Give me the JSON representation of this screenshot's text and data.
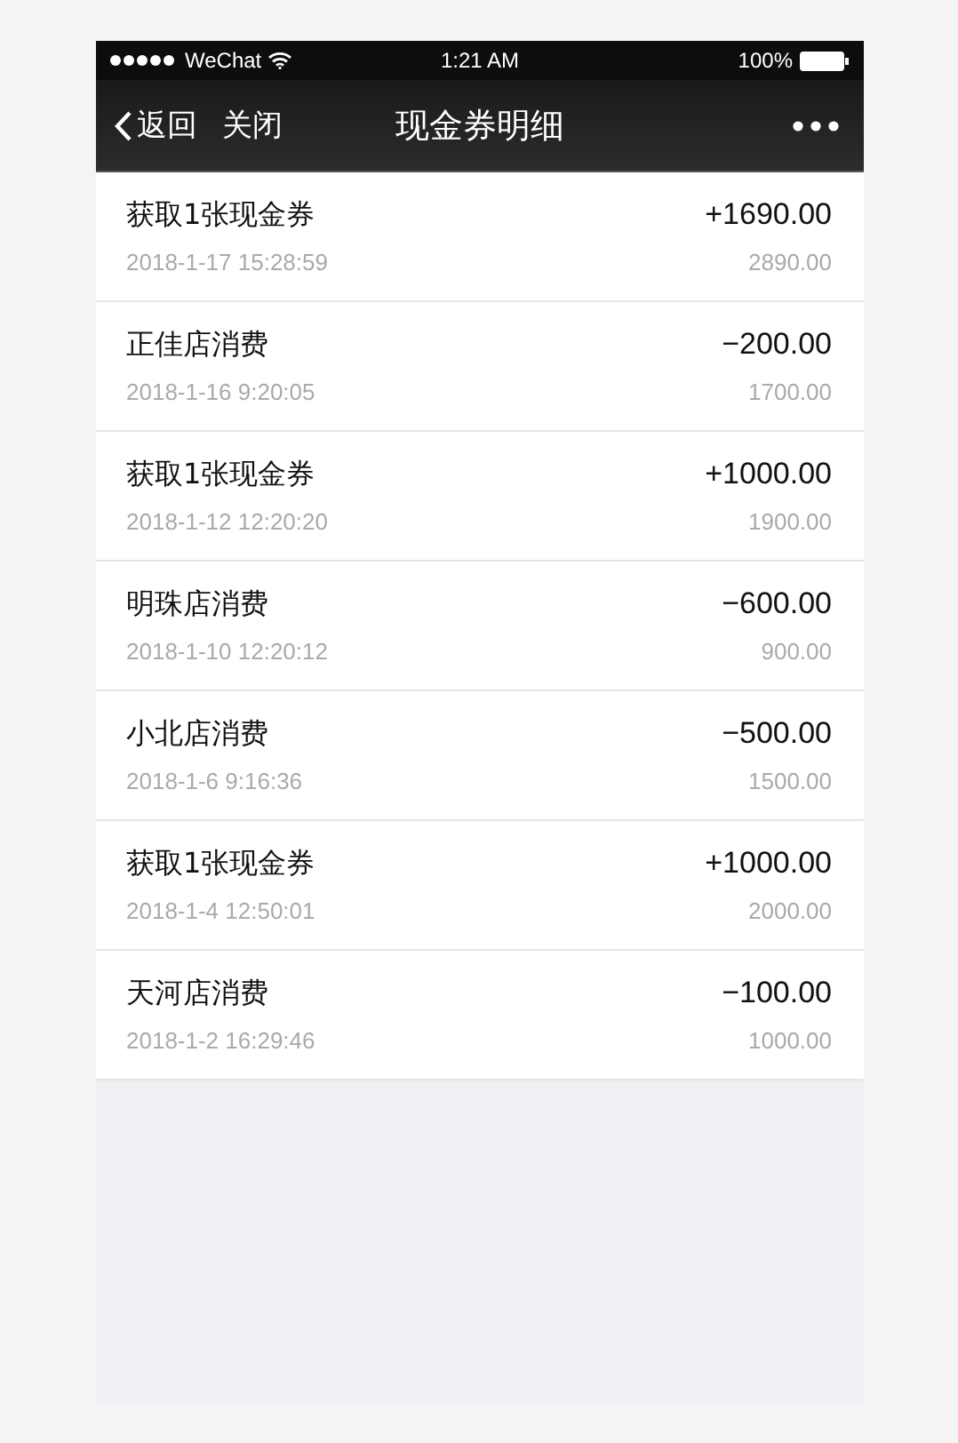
{
  "status_bar": {
    "carrier": "WeChat",
    "time": "1:21 AM",
    "battery": "100%"
  },
  "nav": {
    "back": "返回",
    "close": "关闭",
    "title": "现金券明细"
  },
  "records": [
    {
      "title": "获取1张现金券",
      "time": "2018-1-17 15:28:59",
      "amount": "+1690.00",
      "balance": "2890.00"
    },
    {
      "title": "正佳店消费",
      "time": "2018-1-16 9:20:05",
      "amount": "−200.00",
      "balance": "1700.00"
    },
    {
      "title": "获取1张现金券",
      "time": "2018-1-12 12:20:20",
      "amount": "+1000.00",
      "balance": "1900.00"
    },
    {
      "title": "明珠店消费",
      "time": "2018-1-10 12:20:12",
      "amount": "−600.00",
      "balance": "900.00"
    },
    {
      "title": "小北店消费",
      "time": "2018-1-6 9:16:36",
      "amount": "−500.00",
      "balance": "1500.00"
    },
    {
      "title": "获取1张现金券",
      "time": "2018-1-4 12:50:01",
      "amount": "+1000.00",
      "balance": "2000.00"
    },
    {
      "title": "天河店消费",
      "time": "2018-1-2 16:29:46",
      "amount": "−100.00",
      "balance": "1000.00"
    }
  ]
}
